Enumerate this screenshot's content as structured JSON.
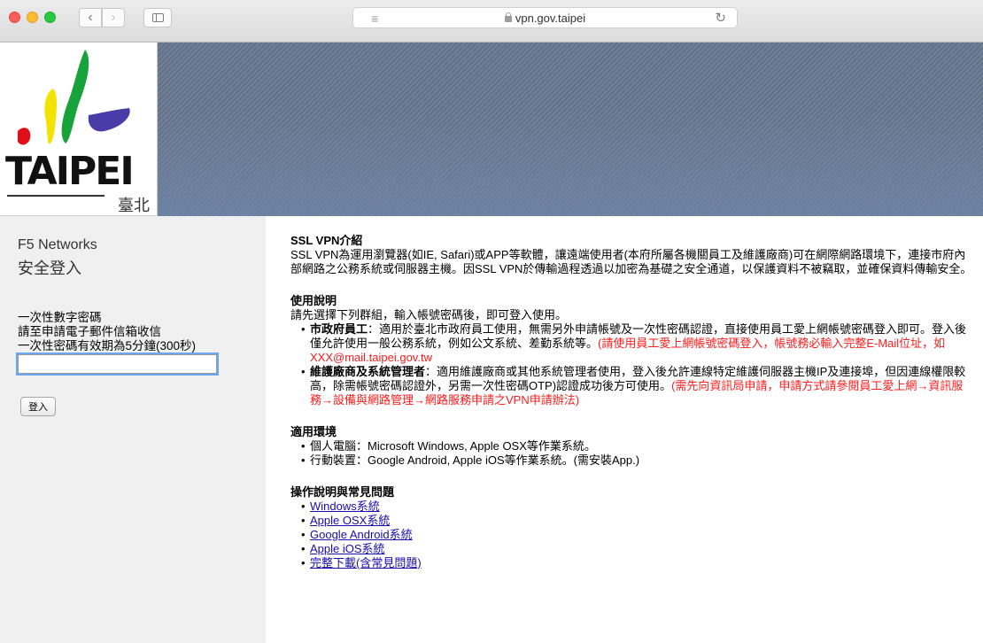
{
  "browser": {
    "url": "vpn.gov.taipei",
    "back_glyph": "‹",
    "forward_glyph": "›",
    "reader_glyph": "≡",
    "reload_glyph": "↻"
  },
  "logo": {
    "word": "TAIPEI",
    "sub": "臺北"
  },
  "login": {
    "brand": "F5 Networks",
    "title": "安全登入",
    "msg_line1": "一次性數字密碼",
    "msg_line2": "請至申請電子郵件信箱收信",
    "msg_line3": "一次性密碼有效期為5分鐘(300秒)",
    "otp_value": "",
    "button_label": "登入"
  },
  "intro": {
    "heading": "SSL VPN介紹",
    "body": "SSL VPN為運用瀏覽器(如IE, Safari)或APP等軟體，讓遠端使用者(本府所屬各機關員工及維護廠商)可在網際網路環境下，連接市府內部網路之公務系統或伺服器主機。因SSL VPN於傳輸過程透過以加密為基礎之安全通道，以保護資料不被竊取，並確保資料傳輸安全。"
  },
  "usage": {
    "heading": "使用說明",
    "intro": "請先選擇下列群組，輸入帳號密碼後，即可登入使用。",
    "items": [
      {
        "title": "市政府員工",
        "text": "：適用於臺北市政府員工使用，無需另外申請帳號及一次性密碼認證，直接使用員工愛上網帳號密碼登入即可。登入後僅允許使用一般公務系統，例如公文系統、差勤系統等。",
        "note": "(請使用員工愛上網帳號密碼登入，帳號務必輸入完整E-Mail位址，如XXX@mail.taipei.gov.tw"
      },
      {
        "title": "維護廠商及系統管理者",
        "text": "：適用維護廠商或其他系統管理者使用，登入後允許連線特定維護伺服器主機IP及連接埠，但因連線權限較高，除需帳號密碼認證外，另需一次性密碼OTP)認證成功後方可使用。",
        "note": "(需先向資訊局申請，申請方式請參閱員工愛上網→資訊服務→設備與網路管理→網路服務申請之VPN申請辦法)"
      }
    ]
  },
  "env": {
    "heading": "適用環境",
    "items": [
      "個人電腦：Microsoft Windows, Apple OSX等作業系統。",
      "行動裝置：Google Android, Apple iOS等作業系統。(需安裝App.)"
    ]
  },
  "faq": {
    "heading": "操作說明與常見問題",
    "links": [
      "Windows系統",
      "Apple OSX系統",
      "Google Android系統",
      "Apple iOS系統",
      "完整下載(含常見問題)"
    ]
  }
}
